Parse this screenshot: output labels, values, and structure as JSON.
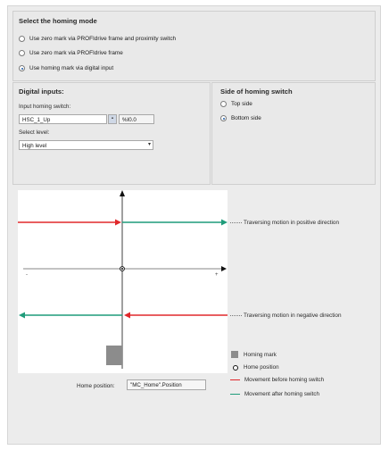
{
  "mode_section": {
    "title": "Select the homing mode",
    "options": [
      {
        "label": "Use zero mark via PROFIdrive frame and proximity switch",
        "selected": false
      },
      {
        "label": "Use zero mark via PROFIdrive frame",
        "selected": false
      },
      {
        "label": "Use homing mark via digital input",
        "selected": true
      }
    ]
  },
  "digital_inputs": {
    "title": "Digital inputs:",
    "input_label": "Input homing switch:",
    "input_value": "HSC_1_Up",
    "address_value": "%I0.0",
    "level_label": "Select level:",
    "level_value": "High level"
  },
  "side": {
    "title": "Side of homing switch",
    "options": [
      {
        "label": "Top side",
        "selected": false
      },
      {
        "label": "Bottom side",
        "selected": true
      }
    ]
  },
  "diagram": {
    "pos_label": "Traversing motion in positive direction",
    "neg_label": "Traversing motion in negative direction",
    "minus_tick": "-",
    "plus_tick": "+"
  },
  "home_position": {
    "label": "Home position:",
    "value": "\"MC_Home\".Position"
  },
  "legend": {
    "homing_mark": "Homing mark",
    "home_position": "Home position",
    "before": "Movement before homing switch",
    "after": "Movement after homing switch"
  },
  "colors": {
    "red": "#e0282b",
    "green": "#1f9c7a",
    "mark": "#8c8c8c"
  }
}
